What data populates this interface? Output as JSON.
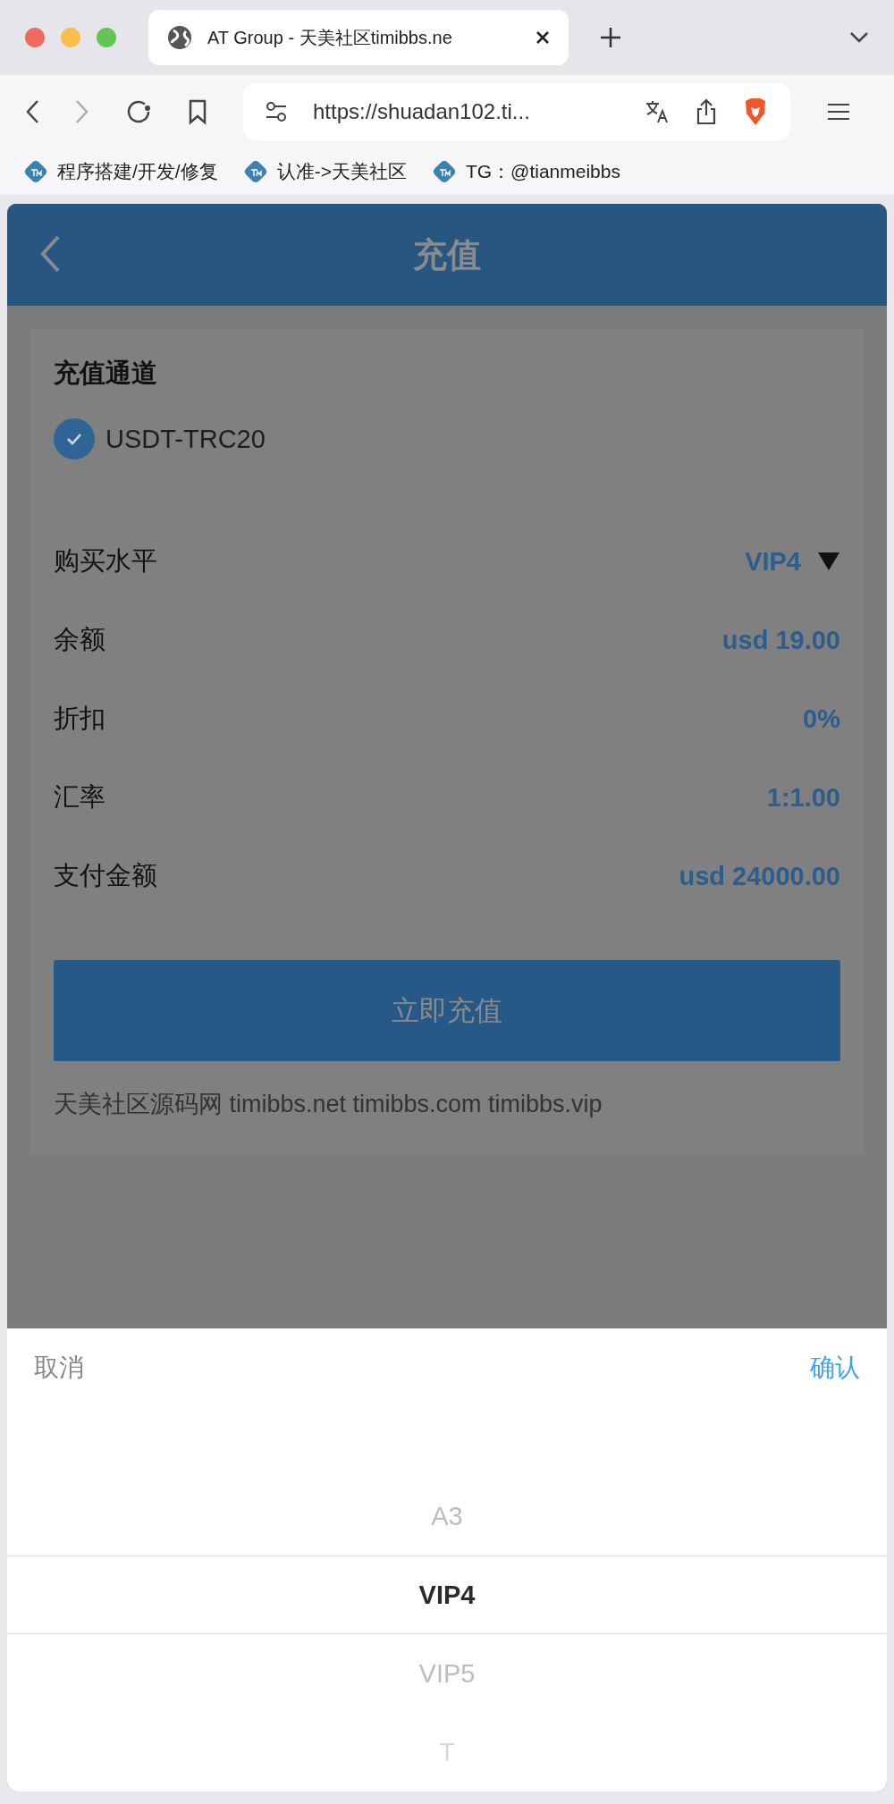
{
  "browser": {
    "tab_title": "AT Group - 天美社区timibbs.ne",
    "url": "https://shuadan102.ti...",
    "bookmarks": [
      {
        "label": "程序搭建/开发/修复"
      },
      {
        "label": "认准->天美社区"
      },
      {
        "label": "TG：@tianmeibbs"
      }
    ]
  },
  "page": {
    "title": "充值",
    "section_title": "充值通道",
    "channel": {
      "label": "USDT-TRC20",
      "checked": true
    },
    "rows": [
      {
        "label": "购买水平",
        "value": "VIP4",
        "kind": "select"
      },
      {
        "label": "余额",
        "value": "usd 19.00",
        "kind": "value"
      },
      {
        "label": "折扣",
        "value": "0%",
        "kind": "value"
      },
      {
        "label": "汇率",
        "value": "1:1.00",
        "kind": "value"
      },
      {
        "label": "支付金额",
        "value": "usd 24000.00",
        "kind": "value"
      }
    ],
    "button": "立即充值",
    "footer": "天美社区源码网 timibbs.net timibbs.com timibbs.vip"
  },
  "picker": {
    "cancel": "取消",
    "confirm": "确认",
    "options": [
      {
        "label": "A3",
        "selected": false
      },
      {
        "label": "VIP4",
        "selected": true
      },
      {
        "label": "VIP5",
        "selected": false
      },
      {
        "label": "T",
        "selected": false
      }
    ]
  }
}
